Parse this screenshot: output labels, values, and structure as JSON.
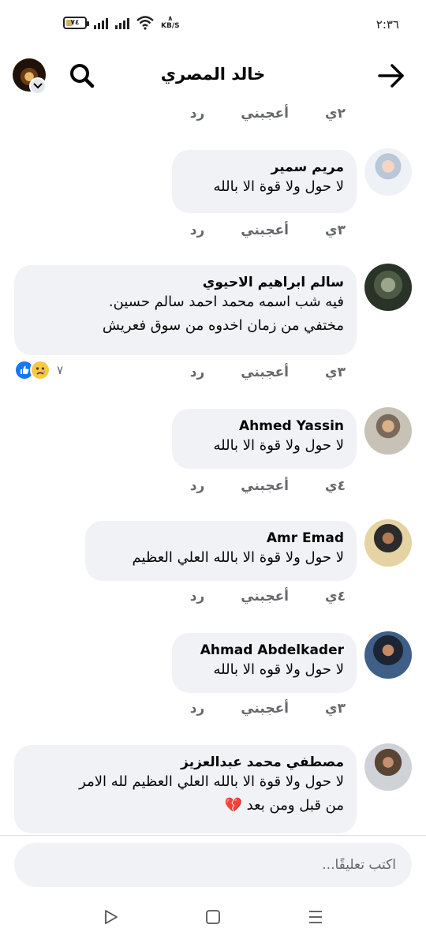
{
  "status_bar": {
    "time": "٢:٣٦",
    "battery": "٧٤",
    "network_speed_arrow": "∧",
    "network_speed_unit": "KB/S"
  },
  "header": {
    "title": "خالد المصري"
  },
  "top_actions": {
    "time": "٢ي",
    "like": "أعجبني",
    "reply": "رد"
  },
  "comments": [
    {
      "name": "مريم سمير",
      "lines": [
        "لا حول ولا قوة الا بالله"
      ],
      "time": "٣ي",
      "like": "أعجبني",
      "reply": "رد"
    },
    {
      "name": "سالم ابراهيم الاحيوي",
      "lines": [
        "فيه شب اسمه محمد احمد سالم حسين.",
        "مختفي من زمان اخدوه من سوق فعريش"
      ],
      "time": "٣ي",
      "like": "أعجبني",
      "reply": "رد",
      "reaction_count": "٧"
    },
    {
      "name": "Ahmed Yassin",
      "lines": [
        "لا حول ولا قوة الا بالله"
      ],
      "time": "٤ي",
      "like": "أعجبني",
      "reply": "رد"
    },
    {
      "name": "Amr Emad",
      "lines": [
        "لا حول ولا قوة الا بالله العلي العظيم"
      ],
      "time": "٤ي",
      "like": "أعجبني",
      "reply": "رد"
    },
    {
      "name": "Ahmad Abdelkader",
      "lines": [
        "لا حول ولا قوه الا بالله"
      ],
      "time": "٣ي",
      "like": "أعجبني",
      "reply": "رد"
    },
    {
      "name": "مصطفي محمد عبدالعزيز",
      "lines": [
        "لا حول ولا قوة الا بالله العلي العظيم لله الامر",
        "من قبل ومن بعد 💔"
      ]
    }
  ],
  "comment_box": {
    "placeholder": "اكتب تعليقًا..."
  },
  "colors": {
    "bubble": "#f0f2f5",
    "meta_text": "#65676b",
    "like_blue": "#1877f2",
    "sad_yellow": "#f7c843"
  },
  "icons": [
    "back-arrow-icon",
    "search-icon",
    "chevron-down-icon",
    "like-reaction-icon",
    "sad-reaction-icon",
    "back-triangle-icon",
    "home-square-icon",
    "menu-lines-icon",
    "wifi-icon",
    "signal-icon",
    "battery-icon"
  ]
}
